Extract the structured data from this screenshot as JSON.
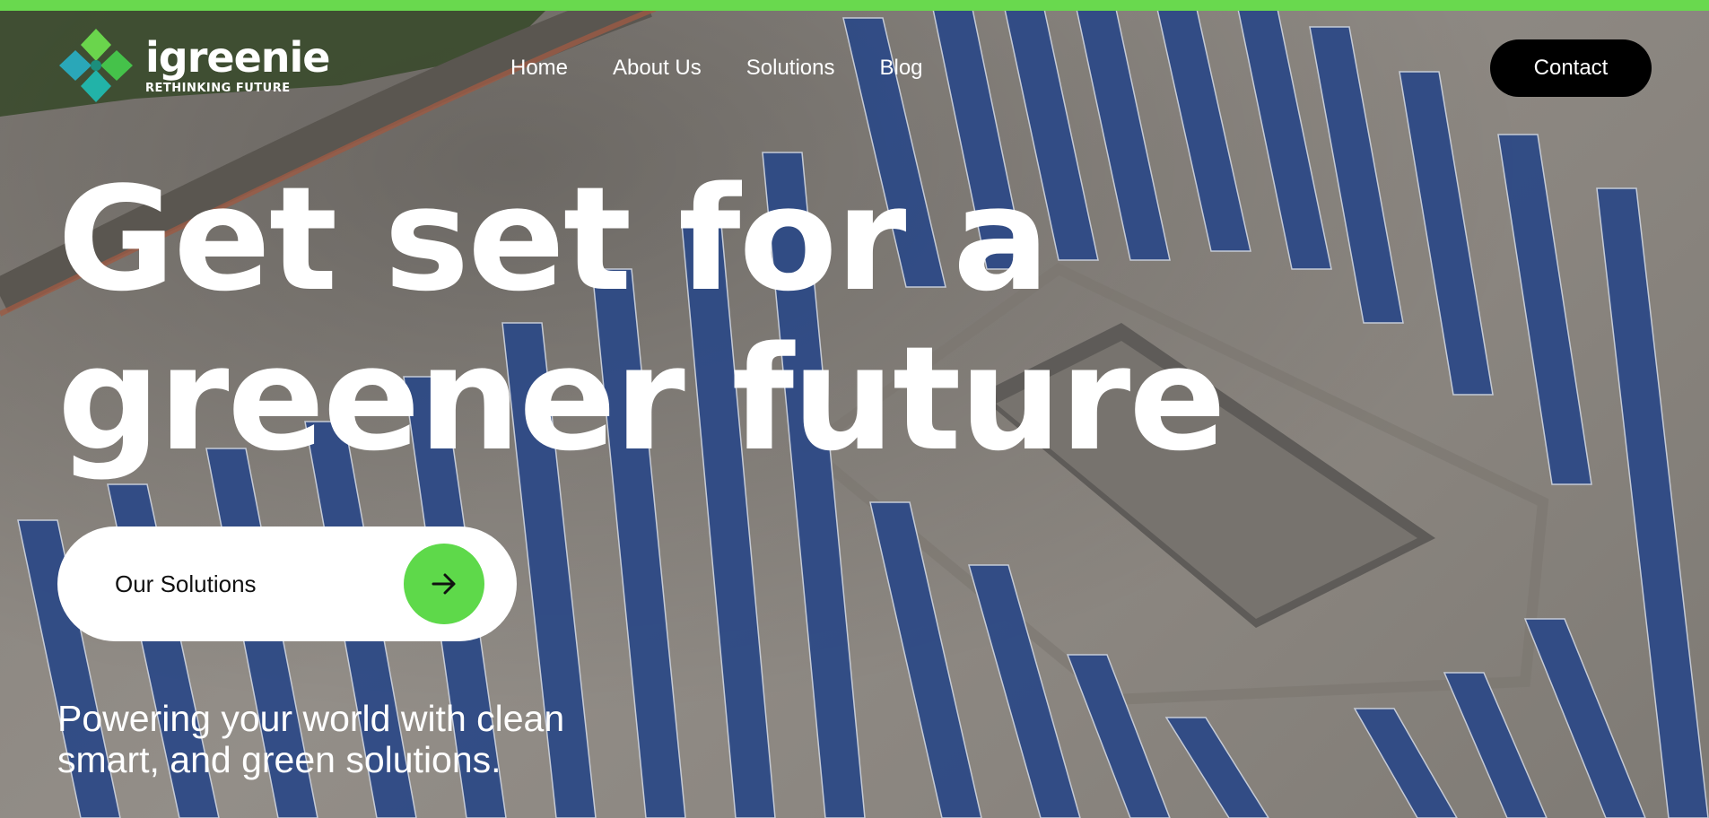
{
  "brand": {
    "name": "igreenie",
    "tagline": "RETHINKING FUTURE",
    "icon": "clover-logo-icon",
    "colors": {
      "accent": "#69d94e",
      "logo_teal": "#22b3a8",
      "logo_green": "#6ad54c"
    }
  },
  "nav": {
    "items": [
      {
        "label": "Home"
      },
      {
        "label": "About Us"
      },
      {
        "label": "Solutions"
      },
      {
        "label": "Blog"
      }
    ]
  },
  "header": {
    "contact_label": "Contact"
  },
  "hero": {
    "headline_line1": "Get set for a",
    "headline_line2": "greener future",
    "cta_label": "Our Solutions",
    "cta_icon": "arrow-right-icon",
    "subtitle_line1": "Powering your world with clean",
    "subtitle_line2": "smart, and green solutions.",
    "background_icon": "solar-panel-rooftop-image"
  }
}
